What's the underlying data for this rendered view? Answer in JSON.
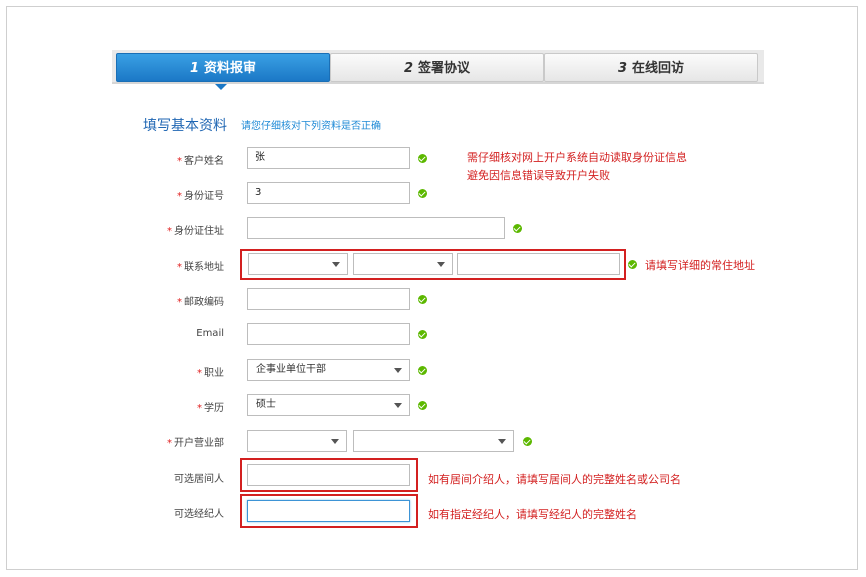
{
  "steps": [
    {
      "num": "1",
      "label": "资料报审"
    },
    {
      "num": "2",
      "label": "签署协议"
    },
    {
      "num": "3",
      "label": "在线回访"
    }
  ],
  "section": {
    "title": "填写基本资料",
    "hint": "请您仔细核对下列资料是否正确"
  },
  "required_mark": "*",
  "fields": {
    "name": {
      "label": "客户姓名",
      "value": "张"
    },
    "id_number": {
      "label": "身份证号",
      "value": "3"
    },
    "id_address": {
      "label": "身份证住址",
      "value": ""
    },
    "contact_address": {
      "label": "联系地址",
      "province": "",
      "city": "",
      "detail": ""
    },
    "postcode": {
      "label": "邮政编码",
      "value": ""
    },
    "email": {
      "label": "Email",
      "value": ""
    },
    "job": {
      "label": "职业",
      "value": "企事业单位干部"
    },
    "education": {
      "label": "学历",
      "value": "硕士"
    },
    "branch": {
      "label": "开户营业部",
      "city": "",
      "branch": ""
    },
    "intermediary": {
      "label": "可选居间人",
      "value": ""
    },
    "broker": {
      "label": "可选经纪人",
      "value": ""
    }
  },
  "notes": {
    "id_line1": "需仔细核对网上开户系统自动读取身份证信息",
    "id_line2": "避免因信息错误导致开户失败",
    "address": "请填写详细的常住地址",
    "intermediary": "如有居间介绍人，请填写居间人的完整姓名或公司名",
    "broker": "如有指定经纪人，请填写经纪人的完整姓名"
  },
  "colors": {
    "active_step": "#1b78c6",
    "section_title": "#1f66b3",
    "hint": "#1f8ad6",
    "required": "#e02020",
    "valid": "#5cb800",
    "annotation": "#d32020"
  }
}
